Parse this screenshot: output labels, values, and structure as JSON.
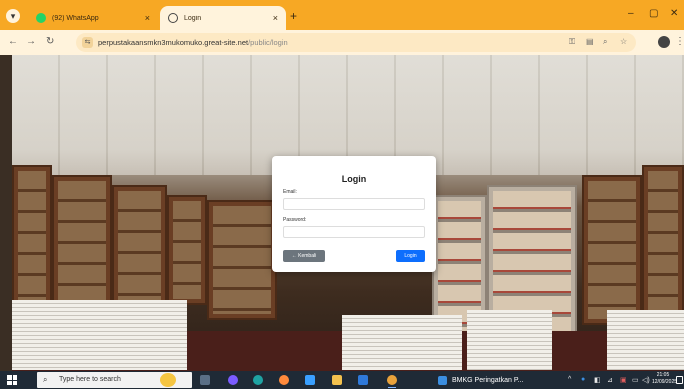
{
  "browser": {
    "tabs": [
      {
        "label": "(92) WhatsApp",
        "icon": "whatsapp-icon",
        "active": false
      },
      {
        "label": "Login",
        "icon": "globe-icon",
        "active": true
      }
    ],
    "new_tab_label": "+",
    "close_glyph": "×",
    "window_controls": {
      "minimize": "–",
      "maximize": "▢",
      "close": "✕"
    },
    "address": {
      "host": "perpustakaansmkn3mukomuko.great-site.net",
      "path": "/public/login"
    },
    "nav": {
      "back": "←",
      "forward": "→",
      "reload": "↻"
    },
    "accent_color": "#f7a824"
  },
  "login_card": {
    "title": "Login",
    "email_label": "Email:",
    "email_value": "",
    "password_label": "Password:",
    "password_value": "",
    "back_button": "← Kembali",
    "login_button": "Login",
    "primary_color": "#0d6efd",
    "secondary_color": "#6c757d"
  },
  "taskbar": {
    "search_placeholder": "Type here to search",
    "running_app": "BMKG Peringatkan P...",
    "clock_time": "21:05",
    "clock_date": "12/09/2025"
  }
}
